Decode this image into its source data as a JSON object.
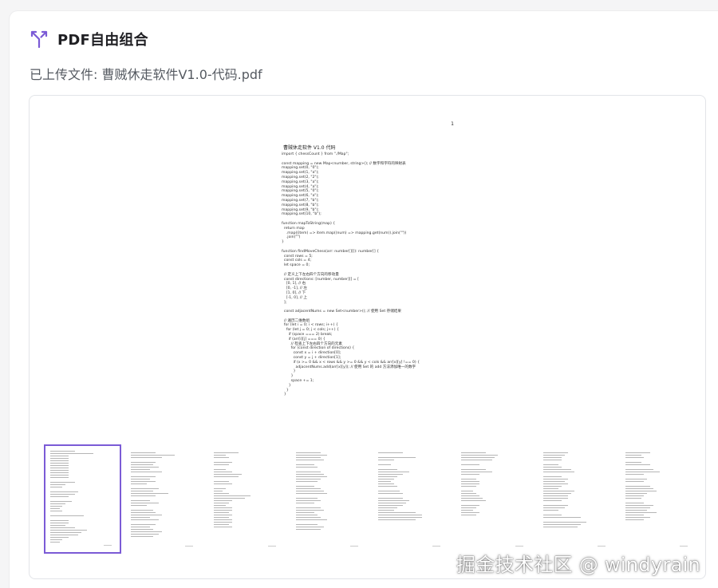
{
  "header": {
    "title": "PDF自由组合",
    "icon": "merge-arrows-icon",
    "accent_color": "#7b5bd6"
  },
  "file": {
    "uploaded_label": "已上传文件: 曹贼休走软件V1.0-代码.pdf"
  },
  "preview": {
    "page_number": "1",
    "page_title": "曹贼休走软件 V1.0    代码",
    "code": "import { chessCount } from \"./Map\";\n\nconst mapping = new Map<number, string>(); // 数字和字符的映射表\nmapping.set(0, \"0\");\nmapping.set(1, \"a\");\nmapping.set(2, \"2\");\nmapping.set(3, \"a\");\nmapping.set(4, \"a\");\nmapping.set(5, \"0\");\nmapping.set(6, \"a\");\nmapping.set(7, \"b\");\nmapping.set(8, \"b\");\nmapping.set(9, \"b\");\nmapping.set(10, \"b\");\n\nfunction mapToString(map) {\n  return map\n    .map((item) => item.map((num) => mapping.get(num)).join(\"\"))\n    .join(\"\")\n}\n\nfunction findMoveChess(arr: number[][]): number[] {\n  const rows = 5;\n  const cols = 4;\n  let space = 0;\n\n  // 定义上下左右四个方向的移动量\n  const directions: [number, number][] = [\n    [0, 1], // 右\n    [0, -1], // 左\n    [1, 0], // 下\n    [-1, 0], // 上\n  ];\n\n  const adjacentNums = new Set<number>(); // 使用 Set 存储结果\n\n  // 遍历二维数组\n  for (let i = 0; i < rows; i++) {\n    for (let j = 0; j < cols; j++) {\n      if (space === 2) break;\n      if (arr[i][j] === 0) {\n        // 检查上下左右四个方向的元素\n        for (const direction of directions) {\n          const x = i + direction[0];\n          const y = j + direction[1];\n          if (x >= 0 && x < rows && y >= 0 && y < cols && arr[x][y] !== 0) {\n            adjacentNums.add(arr[x][y]); // 使用 Set 的 add 方法添加唯一的数字\n          }\n        }\n        space += 1;\n      }\n    }\n  }"
  },
  "thumbnails": [
    {
      "label": "page-1",
      "selected": true
    },
    {
      "label": "page-2",
      "selected": false
    },
    {
      "label": "page-3",
      "selected": false
    },
    {
      "label": "page-4",
      "selected": false
    },
    {
      "label": "page-5",
      "selected": false
    },
    {
      "label": "page-6",
      "selected": false
    },
    {
      "label": "page-7",
      "selected": false
    },
    {
      "label": "page-8",
      "selected": false
    }
  ],
  "watermark": "掘金技术社区 @ windyrain"
}
